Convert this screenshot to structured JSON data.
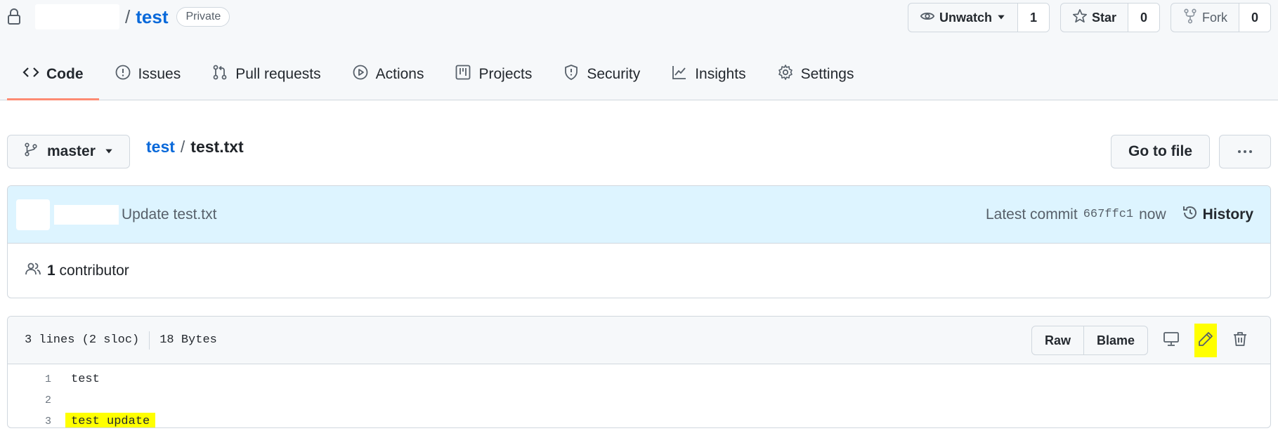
{
  "repo": {
    "name": "test",
    "visibility": "Private"
  },
  "actions": {
    "watch_label": "Unwatch",
    "watch_count": "1",
    "star_label": "Star",
    "star_count": "0",
    "fork_label": "Fork",
    "fork_count": "0"
  },
  "tabs": [
    {
      "label": "Code",
      "icon": "code-icon",
      "active": true
    },
    {
      "label": "Issues",
      "icon": "issue-icon"
    },
    {
      "label": "Pull requests",
      "icon": "pull-request-icon"
    },
    {
      "label": "Actions",
      "icon": "play-icon"
    },
    {
      "label": "Projects",
      "icon": "project-icon"
    },
    {
      "label": "Security",
      "icon": "shield-icon"
    },
    {
      "label": "Insights",
      "icon": "graph-icon"
    },
    {
      "label": "Settings",
      "icon": "gear-icon"
    }
  ],
  "file_nav": {
    "branch": "master",
    "breadcrumb_repo": "test",
    "breadcrumb_sep": "/",
    "file_name": "test.txt",
    "goto_label": "Go to file"
  },
  "commit": {
    "message": "Update test.txt",
    "latest_label": "Latest commit",
    "sha": "667ffc1",
    "time": "now",
    "history_label": "History"
  },
  "contributors": {
    "count": "1",
    "label": "contributor"
  },
  "file": {
    "lines_info": "3 lines (2 sloc)",
    "size": "18 Bytes",
    "raw_label": "Raw",
    "blame_label": "Blame",
    "lines": [
      {
        "num": "1",
        "text": "test"
      },
      {
        "num": "2",
        "text": ""
      },
      {
        "num": "3",
        "text": "test update"
      }
    ]
  },
  "colors": {
    "accent": "#0969da",
    "tab_underline": "#fd8c73",
    "highlight": "#ffff00",
    "commit_bg": "#ddf4ff"
  }
}
